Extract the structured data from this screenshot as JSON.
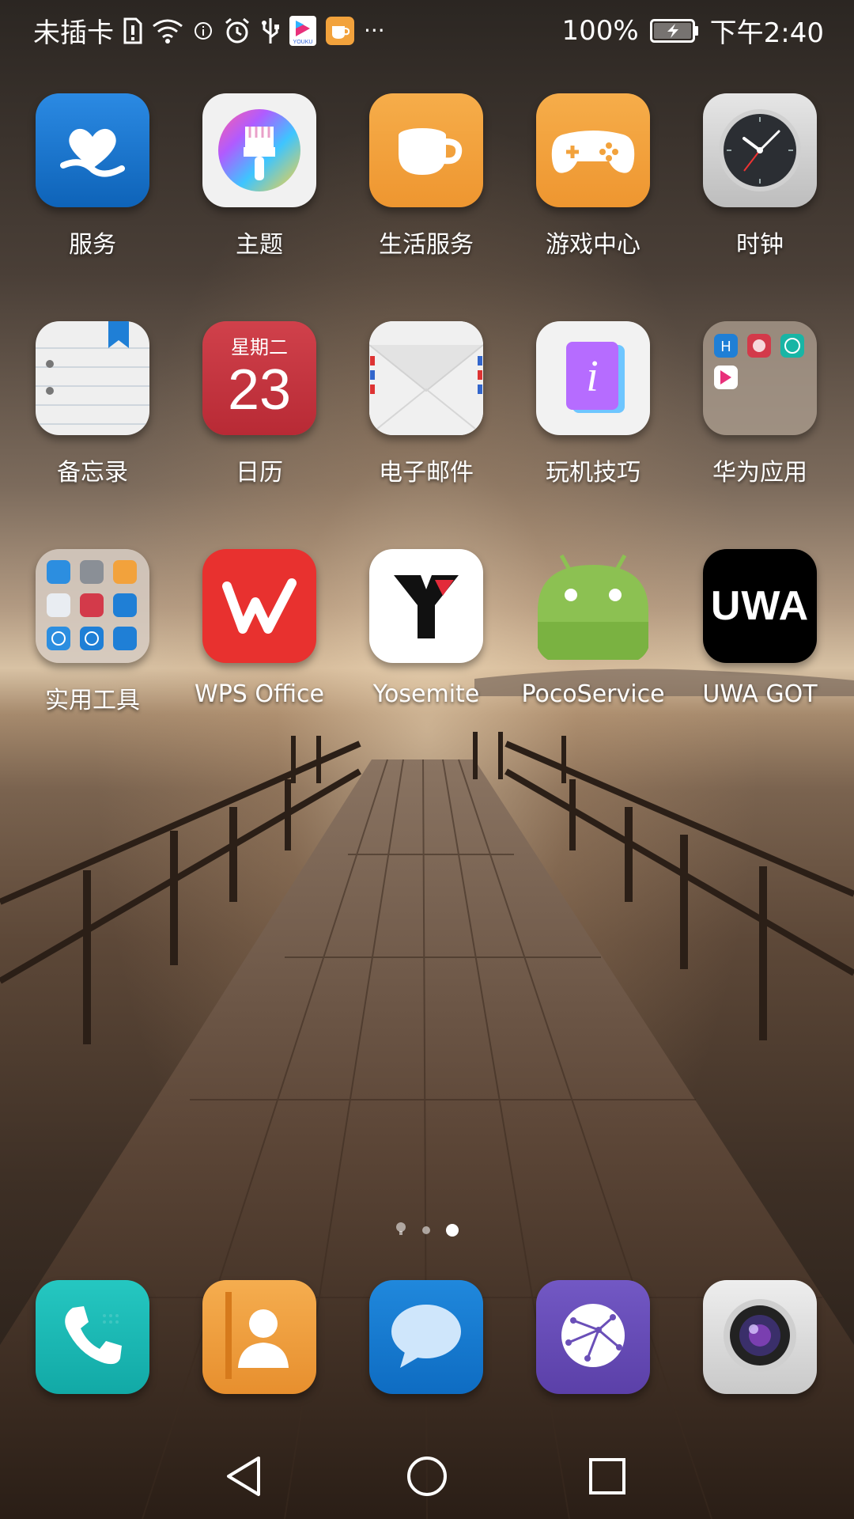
{
  "status_bar": {
    "sim": "未插卡",
    "battery": "100%",
    "time": "下午2:40",
    "more": "···",
    "icons": [
      "sim-alert-icon",
      "wifi-icon",
      "info-icon",
      "alarm-icon",
      "usb-icon",
      "youku-icon",
      "coffee-icon",
      "battery-charging-icon"
    ]
  },
  "apps": [
    {
      "label": "服务",
      "icon": "heart-hand-icon",
      "color": "#1E7FD8"
    },
    {
      "label": "主题",
      "icon": "paintbrush-icon",
      "color": "#F2F2F2"
    },
    {
      "label": "生活服务",
      "icon": "coffee-cup-icon",
      "color": "#F2A23C"
    },
    {
      "label": "游戏中心",
      "icon": "gamepad-icon",
      "color": "#F2A23C"
    },
    {
      "label": "时钟",
      "icon": "clock-icon",
      "color": "#D9D9D9"
    },
    {
      "label": "备忘录",
      "icon": "notepad-icon",
      "color": "#EFEFEF"
    },
    {
      "label": "日历",
      "icon": "calendar-icon",
      "color": "#C8323C",
      "weekday": "星期二",
      "day": "23"
    },
    {
      "label": "电子邮件",
      "icon": "envelope-icon",
      "color": "#F2F2F2"
    },
    {
      "label": "玩机技巧",
      "icon": "tips-icon",
      "color": "#F2F2F2",
      "glyph": "i"
    },
    {
      "label": "华为应用",
      "icon": "folder-icon",
      "color": "#8B7A6C"
    },
    {
      "label": "实用工具",
      "icon": "tools-folder-icon",
      "color": "#C9BDB0"
    },
    {
      "label": "WPS Office",
      "icon": "wps-icon",
      "color": "#E8312F"
    },
    {
      "label": "Yosemite",
      "icon": "yosemite-icon",
      "color": "#FFFFFF"
    },
    {
      "label": "PocoService",
      "icon": "android-icon",
      "color": "#8CC152"
    },
    {
      "label": "UWA GOT",
      "icon": "uwa-icon",
      "color": "#000000",
      "glyph": "UWA"
    }
  ],
  "dock": [
    {
      "name": "phone",
      "icon": "phone-icon",
      "color": "#1CB9B5"
    },
    {
      "name": "contacts",
      "icon": "contacts-icon",
      "color": "#F0A040"
    },
    {
      "name": "messages",
      "icon": "message-icon",
      "color": "#1B7FD2"
    },
    {
      "name": "browser",
      "icon": "browser-icon",
      "color": "#6A4FB8"
    },
    {
      "name": "camera",
      "icon": "camera-icon",
      "color": "#DADADA"
    }
  ],
  "page_indicator": {
    "pages": 3,
    "current": 3
  },
  "nav": [
    "back-icon",
    "home-icon",
    "recents-icon"
  ]
}
